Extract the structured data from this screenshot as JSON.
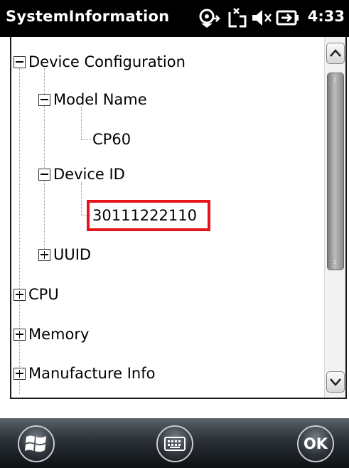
{
  "app": {
    "title": "SystemInformation",
    "time": "4:33"
  },
  "status_icons": [
    "roaming-signal-icon",
    "no-connection-icon",
    "speaker-muted-icon",
    "battery-charging-icon"
  ],
  "tree": {
    "device_configuration": "Device Configuration",
    "model_name": "Model Name",
    "model_value": "CP60",
    "device_id": "Device ID",
    "device_id_value": "30111222110",
    "uuid": "UUID",
    "cpu": "CPU",
    "memory": "Memory",
    "manufacture_info": "Manufacture Info"
  },
  "bottom_bar": {
    "ok_label": "OK"
  },
  "colors": {
    "highlight": "#e8141c",
    "titlebar": "#000000"
  }
}
